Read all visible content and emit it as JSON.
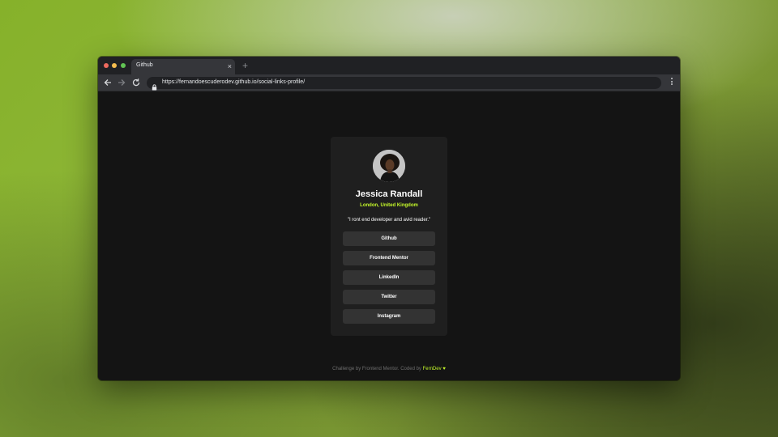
{
  "browser": {
    "tab_title": "Github",
    "tab_close": "×",
    "new_tab": "+",
    "url": "https://fernandoescuderodev.github.io/social-links-profile/"
  },
  "profile": {
    "name": "Jessica Randall",
    "location": "London, United Kingdom",
    "bio": "\"I ront end developer and avid reader.\""
  },
  "links": [
    {
      "label": "Github"
    },
    {
      "label": "Frontend Mentor"
    },
    {
      "label": "LinkedIn"
    },
    {
      "label": "Twitter"
    },
    {
      "label": "Instagram"
    }
  ],
  "footer": {
    "text": "Challenge by Frontend Mentor. Coded by ",
    "author": "FernDev",
    "heart": "♥"
  },
  "colors": {
    "accent": "#c4f82a",
    "card": "#1f1f1f",
    "button": "#333333",
    "background": "#141414"
  }
}
